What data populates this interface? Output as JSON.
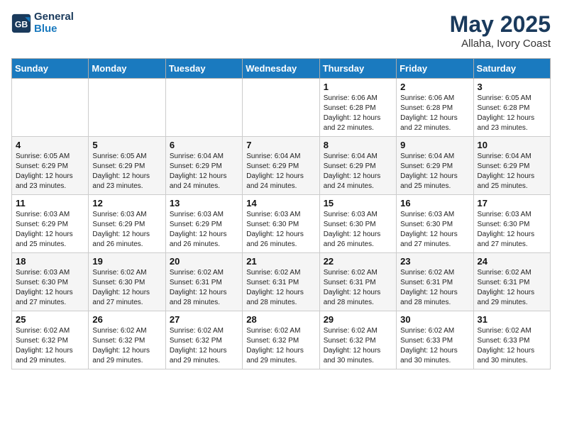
{
  "header": {
    "logo_line1": "General",
    "logo_line2": "Blue",
    "month_year": "May 2025",
    "location": "Allaha, Ivory Coast"
  },
  "weekdays": [
    "Sunday",
    "Monday",
    "Tuesday",
    "Wednesday",
    "Thursday",
    "Friday",
    "Saturday"
  ],
  "weeks": [
    [
      {
        "day": "",
        "info": ""
      },
      {
        "day": "",
        "info": ""
      },
      {
        "day": "",
        "info": ""
      },
      {
        "day": "",
        "info": ""
      },
      {
        "day": "1",
        "info": "Sunrise: 6:06 AM\nSunset: 6:28 PM\nDaylight: 12 hours\nand 22 minutes."
      },
      {
        "day": "2",
        "info": "Sunrise: 6:06 AM\nSunset: 6:28 PM\nDaylight: 12 hours\nand 22 minutes."
      },
      {
        "day": "3",
        "info": "Sunrise: 6:05 AM\nSunset: 6:28 PM\nDaylight: 12 hours\nand 23 minutes."
      }
    ],
    [
      {
        "day": "4",
        "info": "Sunrise: 6:05 AM\nSunset: 6:29 PM\nDaylight: 12 hours\nand 23 minutes."
      },
      {
        "day": "5",
        "info": "Sunrise: 6:05 AM\nSunset: 6:29 PM\nDaylight: 12 hours\nand 23 minutes."
      },
      {
        "day": "6",
        "info": "Sunrise: 6:04 AM\nSunset: 6:29 PM\nDaylight: 12 hours\nand 24 minutes."
      },
      {
        "day": "7",
        "info": "Sunrise: 6:04 AM\nSunset: 6:29 PM\nDaylight: 12 hours\nand 24 minutes."
      },
      {
        "day": "8",
        "info": "Sunrise: 6:04 AM\nSunset: 6:29 PM\nDaylight: 12 hours\nand 24 minutes."
      },
      {
        "day": "9",
        "info": "Sunrise: 6:04 AM\nSunset: 6:29 PM\nDaylight: 12 hours\nand 25 minutes."
      },
      {
        "day": "10",
        "info": "Sunrise: 6:04 AM\nSunset: 6:29 PM\nDaylight: 12 hours\nand 25 minutes."
      }
    ],
    [
      {
        "day": "11",
        "info": "Sunrise: 6:03 AM\nSunset: 6:29 PM\nDaylight: 12 hours\nand 25 minutes."
      },
      {
        "day": "12",
        "info": "Sunrise: 6:03 AM\nSunset: 6:29 PM\nDaylight: 12 hours\nand 26 minutes."
      },
      {
        "day": "13",
        "info": "Sunrise: 6:03 AM\nSunset: 6:29 PM\nDaylight: 12 hours\nand 26 minutes."
      },
      {
        "day": "14",
        "info": "Sunrise: 6:03 AM\nSunset: 6:30 PM\nDaylight: 12 hours\nand 26 minutes."
      },
      {
        "day": "15",
        "info": "Sunrise: 6:03 AM\nSunset: 6:30 PM\nDaylight: 12 hours\nand 26 minutes."
      },
      {
        "day": "16",
        "info": "Sunrise: 6:03 AM\nSunset: 6:30 PM\nDaylight: 12 hours\nand 27 minutes."
      },
      {
        "day": "17",
        "info": "Sunrise: 6:03 AM\nSunset: 6:30 PM\nDaylight: 12 hours\nand 27 minutes."
      }
    ],
    [
      {
        "day": "18",
        "info": "Sunrise: 6:03 AM\nSunset: 6:30 PM\nDaylight: 12 hours\nand 27 minutes."
      },
      {
        "day": "19",
        "info": "Sunrise: 6:02 AM\nSunset: 6:30 PM\nDaylight: 12 hours\nand 27 minutes."
      },
      {
        "day": "20",
        "info": "Sunrise: 6:02 AM\nSunset: 6:31 PM\nDaylight: 12 hours\nand 28 minutes."
      },
      {
        "day": "21",
        "info": "Sunrise: 6:02 AM\nSunset: 6:31 PM\nDaylight: 12 hours\nand 28 minutes."
      },
      {
        "day": "22",
        "info": "Sunrise: 6:02 AM\nSunset: 6:31 PM\nDaylight: 12 hours\nand 28 minutes."
      },
      {
        "day": "23",
        "info": "Sunrise: 6:02 AM\nSunset: 6:31 PM\nDaylight: 12 hours\nand 28 minutes."
      },
      {
        "day": "24",
        "info": "Sunrise: 6:02 AM\nSunset: 6:31 PM\nDaylight: 12 hours\nand 29 minutes."
      }
    ],
    [
      {
        "day": "25",
        "info": "Sunrise: 6:02 AM\nSunset: 6:32 PM\nDaylight: 12 hours\nand 29 minutes."
      },
      {
        "day": "26",
        "info": "Sunrise: 6:02 AM\nSunset: 6:32 PM\nDaylight: 12 hours\nand 29 minutes."
      },
      {
        "day": "27",
        "info": "Sunrise: 6:02 AM\nSunset: 6:32 PM\nDaylight: 12 hours\nand 29 minutes."
      },
      {
        "day": "28",
        "info": "Sunrise: 6:02 AM\nSunset: 6:32 PM\nDaylight: 12 hours\nand 29 minutes."
      },
      {
        "day": "29",
        "info": "Sunrise: 6:02 AM\nSunset: 6:32 PM\nDaylight: 12 hours\nand 30 minutes."
      },
      {
        "day": "30",
        "info": "Sunrise: 6:02 AM\nSunset: 6:33 PM\nDaylight: 12 hours\nand 30 minutes."
      },
      {
        "day": "31",
        "info": "Sunrise: 6:02 AM\nSunset: 6:33 PM\nDaylight: 12 hours\nand 30 minutes."
      }
    ]
  ]
}
